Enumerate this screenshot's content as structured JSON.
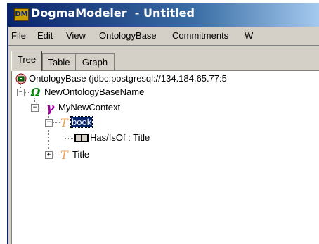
{
  "window": {
    "title": "DogmaModeler  - Untitled",
    "icon_label": "DM"
  },
  "menu": {
    "items": [
      "File",
      "Edit",
      "View",
      "OntologyBase",
      "Commitments",
      "W"
    ]
  },
  "tabs": [
    {
      "label": "Tree",
      "active": true
    },
    {
      "label": "Table",
      "active": false
    },
    {
      "label": "Graph",
      "active": false
    }
  ],
  "tree": {
    "root_label": "OntologyBase (jdbc:postgresql://134.184.65.77:5",
    "base_name": "NewOntologyBaseName",
    "context": "MyNewContext",
    "term1": "book",
    "relation": "Has/IsOf : Title",
    "term2": "Title"
  },
  "colors": {
    "title_start": "#0a246a",
    "selection": "#0a246a",
    "term_icon": "#f0a050",
    "context_icon": "#a000a0",
    "base_icon": "#008000"
  }
}
